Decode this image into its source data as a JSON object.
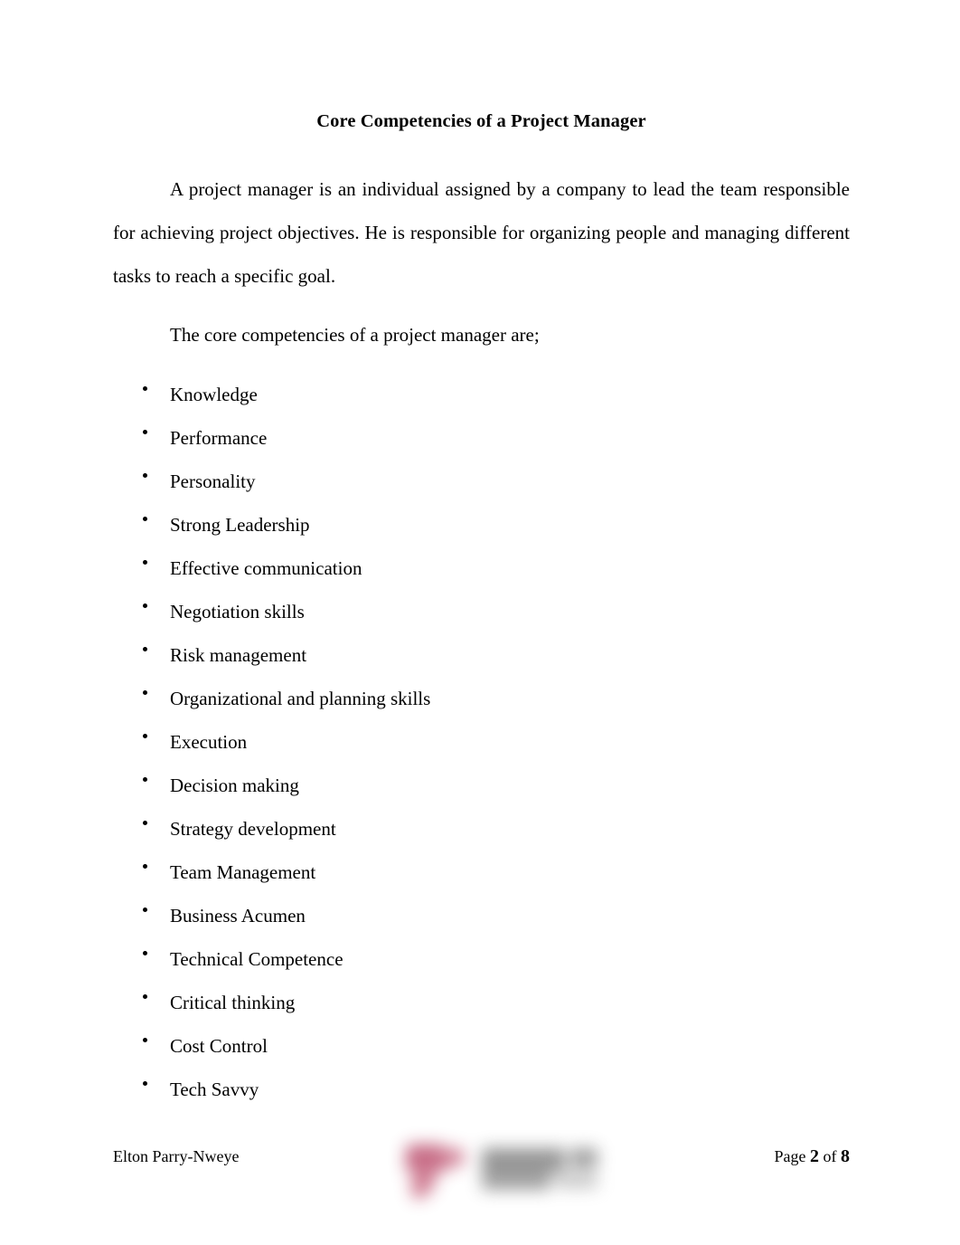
{
  "document": {
    "title": "Core Competencies of a Project Manager",
    "paragraphs": [
      "A project manager is an individual assigned by a company to lead the team responsible for achieving project objectives. He is responsible for organizing people and managing different tasks to reach a specific goal.",
      "The core competencies of a project manager are;"
    ],
    "competencies": [
      "Knowledge",
      "Performance",
      "Personality",
      "Strong Leadership",
      "Effective communication",
      "Negotiation skills",
      "Risk management",
      "Organizational and planning skills",
      "Execution",
      "Decision making",
      "Strategy development",
      "Team Management",
      "Business Acumen",
      "Technical Competence",
      "Critical thinking",
      "Cost Control",
      "Tech Savvy"
    ]
  },
  "footer": {
    "author": "Elton Parry-Nweye",
    "page_label": "Page",
    "page_number": "2",
    "of_label": "of",
    "total_pages": "8",
    "watermark": {
      "name": "redacted-logo-watermark",
      "pink_color": "#c2607c",
      "gray_color": "#8f8f8f"
    }
  },
  "colors": {
    "page_background": "#ffffff",
    "text": "#000000"
  }
}
